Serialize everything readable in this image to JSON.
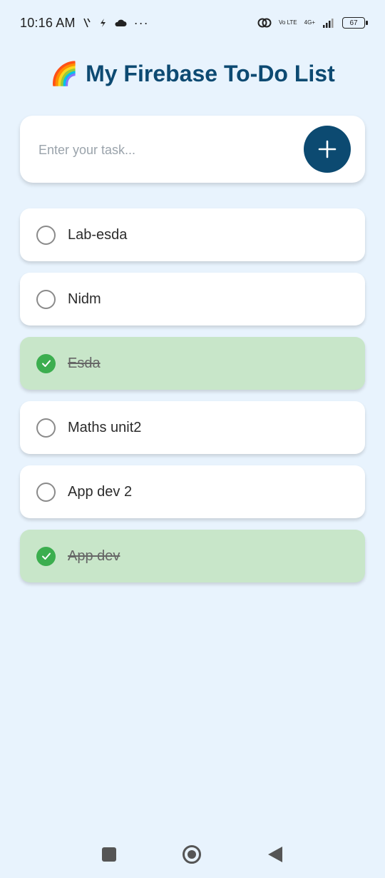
{
  "status_bar": {
    "time": "10:16 AM",
    "more": "···",
    "volte": "Vo LTE",
    "network": "4G+",
    "battery": "67",
    "icons": [
      "vibrate-icon",
      "flash-icon",
      "cloud-icon",
      "link-icon",
      "signal-icon"
    ]
  },
  "app": {
    "emoji": "🌈",
    "title": "My Firebase To-Do List"
  },
  "input": {
    "placeholder": "Enter your task...",
    "value": "",
    "add_icon": "plus-icon",
    "button_color": "#0c4a71"
  },
  "tasks": [
    {
      "label": "Lab-esda",
      "done": false
    },
    {
      "label": "Nidm",
      "done": false
    },
    {
      "label": "Esda",
      "done": true
    },
    {
      "label": "Maths unit2",
      "done": false
    },
    {
      "label": "App dev 2",
      "done": false
    },
    {
      "label": "App dev",
      "done": true
    }
  ],
  "colors": {
    "background": "#e8f3fd",
    "title": "#0d4a72",
    "done_bg": "#c8e6c9",
    "check_green": "#3cae4f"
  },
  "nav": {
    "icons": [
      "recents-icon",
      "home-icon",
      "back-icon"
    ]
  }
}
